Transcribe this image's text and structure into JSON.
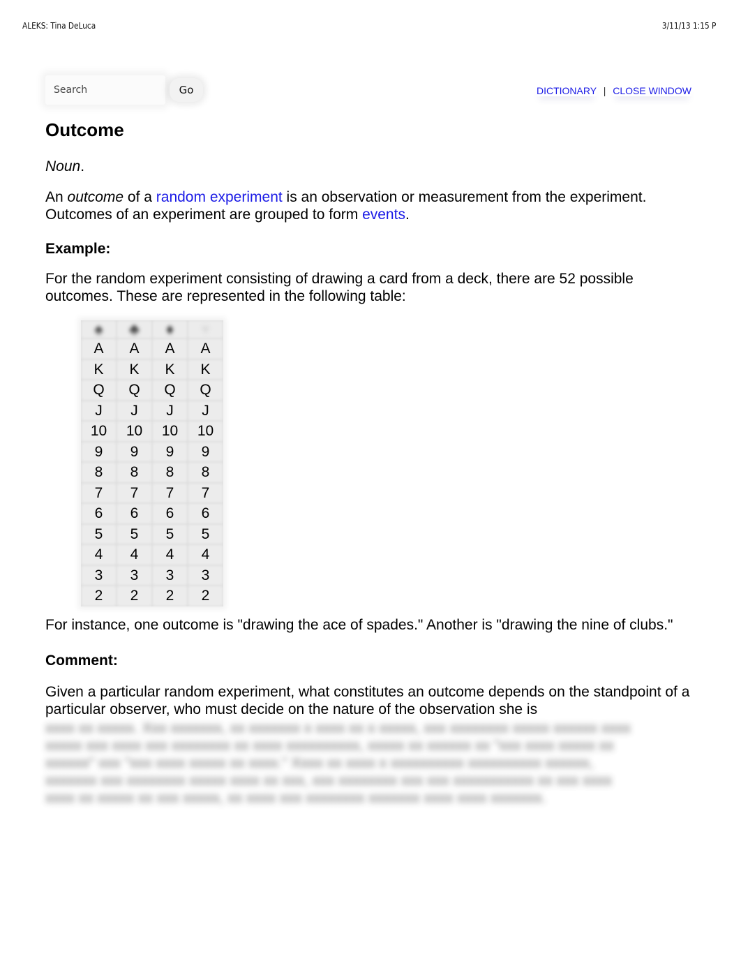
{
  "print_header": {
    "title": "ALEKS: Tina DeLuca",
    "datetime": "3/11/13 1:15 P"
  },
  "toolbar": {
    "search_placeholder": "Search",
    "go_label": "Go",
    "links": [
      {
        "label": "DICTIONARY"
      },
      {
        "label": "CLOSE WINDOW"
      }
    ],
    "separator": "|"
  },
  "entry": {
    "title": "Outcome",
    "part_of_speech": "Noun",
    "part_of_speech_suffix": ".",
    "definition": {
      "part1": "An ",
      "term_italic": "outcome",
      "part2": " of a ",
      "link1": "random experiment",
      "part3": " is an observation or measurement from the experiment. Outcomes of an experiment are grouped to form ",
      "link2": "events",
      "part4": "."
    },
    "example_heading": "Example:",
    "example_intro": "For the random experiment consisting of drawing a card from a deck, there are 52 possible outcomes. These are represented in the following table:",
    "card_table": {
      "suits": [
        {
          "name": "spades-icon",
          "glyph": "♠"
        },
        {
          "name": "clubs-icon",
          "glyph": "♣"
        },
        {
          "name": "diamonds-icon",
          "glyph": "♦"
        },
        {
          "name": "hearts-icon",
          "glyph": "♥"
        }
      ],
      "ranks": [
        "A",
        "K",
        "Q",
        "J",
        "10",
        "9",
        "8",
        "7",
        "6",
        "5",
        "4",
        "3",
        "2"
      ]
    },
    "example_followup": "For instance, one outcome is \"drawing the ace of spades.\" Another is \"drawing the nine of clubs.\"",
    "comment_heading": "Comment:",
    "comment_visible": "Given a particular random experiment, what constitutes an outcome depends on the standpoint of a particular observer, who must decide on the nature of the observation she is",
    "comment_obscured": "xxxx xx xxxxx. Xxx xxxxxxx, xx xxxxxxx x xxxx xx x xxxxx, xxx xxxxxxxx xxxxx xxxxxx xxxx xxxxx xxx xxxx xxx xxxxxxxx xx xxxx xxxxxxxxxx, xxxxx xx xxxxxx xx \"xxx xxxx xxxxx xx xxxxxx\" xxx \"xxx xxxx xxxxx xx xxxx.\" Xxxx xx xxxx x xxxxxxxxxx xxxxxxxxxx xxxxxx, xxxxxxx xxx xxxxxxxx xxxxx xxxx xx xxx, xxx xxxxxxxx xxx xxx xxxxxxxxxxx xx xxx xxxx xxxx xx xxxxx xx xxx xxxxx, xx xxxx xxx xxxxxxxx xxxxxxx xxxx xxxx xxxxxxx."
  }
}
